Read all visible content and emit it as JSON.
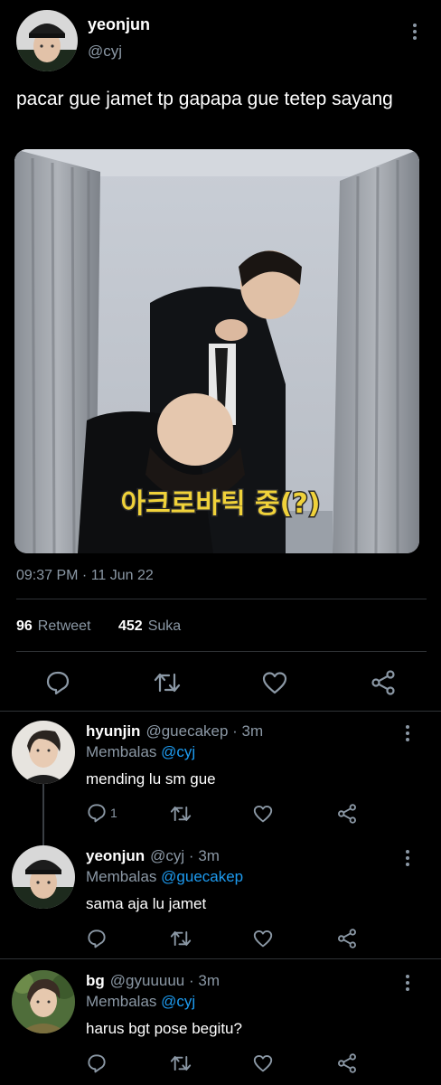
{
  "tweet": {
    "author_name": "yeonjun",
    "author_handle": "@cyj",
    "text": "pacar gue jamet tp gapapa gue tetep sayang",
    "media_caption": "아크로바틱 중(?)",
    "timestamp": "09:37 PM · 11 Jun 22",
    "retweets_count": "96",
    "retweets_label": "Retweet",
    "likes_count": "452",
    "likes_label": "Suka",
    "icons": [
      "reply-icon",
      "retweet-icon",
      "like-icon",
      "share-icon",
      "more-icon"
    ]
  },
  "replies": [
    {
      "name": "hyunjin",
      "handle": "@guecakep · 3m",
      "replying_label": "Membalas",
      "replying_to": "@cyj",
      "text": "mending lu sm gue",
      "reply_count": "1"
    },
    {
      "name": "yeonjun",
      "handle": "@cyj · 3m",
      "replying_label": "Membalas",
      "replying_to": "@guecakep",
      "text": "sama aja lu jamet",
      "reply_count": ""
    },
    {
      "name": "bg",
      "handle": "@gyuuuuu · 3m",
      "replying_label": "Membalas",
      "replying_to": "@cyj",
      "text": "harus bgt pose begitu?",
      "reply_count": ""
    }
  ],
  "colors": {
    "background": "#000000",
    "text": "#e7e9ea",
    "secondary": "#8b98a5",
    "link": "#1d9bf0",
    "divider": "#2f3336"
  }
}
